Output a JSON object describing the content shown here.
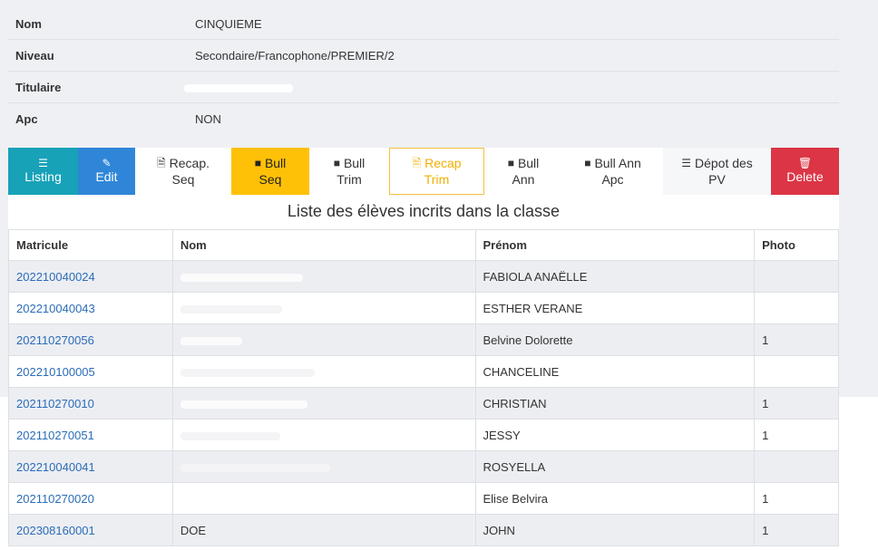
{
  "info": [
    {
      "label": "Nom",
      "value": "CINQUIEME"
    },
    {
      "label": "Niveau",
      "value": "Secondaire/Francophone/PREMIER/2"
    },
    {
      "label": "Titulaire",
      "value": ""
    },
    {
      "label": "Apc",
      "value": "NON"
    }
  ],
  "toolbar": {
    "listing": "Listing",
    "edit": "Edit",
    "recap_seq": [
      "Recap.",
      "Seq"
    ],
    "bull_seq": [
      "Bull",
      "Seq"
    ],
    "bull_trim": [
      "Bull",
      "Trim"
    ],
    "recap_trim": [
      "Recap",
      "Trim"
    ],
    "bull_ann": [
      "Bull",
      "Ann"
    ],
    "bull_ann_apc": [
      "Bull Ann",
      "Apc"
    ],
    "depot_pv": [
      "Dépot des",
      "PV"
    ],
    "delete": "Delete"
  },
  "list_title": "Liste des élèves incrits dans la classe",
  "table": {
    "headers": [
      "Matricule",
      "Nom",
      "Prénom",
      "Photo"
    ],
    "rows": [
      {
        "matricule": "202210040024",
        "nom": "",
        "prenom": "FABIOLA ANAËLLE",
        "photo": ""
      },
      {
        "matricule": "202210040043",
        "nom": "",
        "prenom": "ESTHER VERANE",
        "photo": ""
      },
      {
        "matricule": "202110270056",
        "nom": "",
        "prenom": "Belvine Dolorette",
        "photo": "1"
      },
      {
        "matricule": "202210100005",
        "nom": "",
        "prenom": "CHANCELINE",
        "photo": ""
      },
      {
        "matricule": "202110270010",
        "nom": "",
        "prenom": "CHRISTIAN",
        "photo": "1"
      },
      {
        "matricule": "202110270051",
        "nom": "",
        "prenom": "JESSY",
        "photo": "1"
      },
      {
        "matricule": "202210040041",
        "nom": "",
        "prenom": "ROSYELLA",
        "photo": ""
      },
      {
        "matricule": "202110270020",
        "nom": "",
        "prenom": "Elise Belvira",
        "photo": "1"
      },
      {
        "matricule": "202308160001",
        "nom": "DOE",
        "prenom": "JOHN",
        "photo": "1"
      }
    ]
  },
  "colors": {
    "listing": "#17a2b8",
    "edit": "#2f86d8",
    "bull_seq": "#ffc107",
    "delete": "#dc3545",
    "link": "#2b6cb8"
  },
  "icons": {
    "listing": "list-icon",
    "edit": "edit-icon",
    "recap_seq": "excel-file-icon",
    "bull_seq": "file-icon",
    "bull_trim": "file-icon",
    "recap_trim": "excel-file-icon",
    "bull_ann": "file-icon",
    "bull_ann_apc": "file-icon",
    "depot_pv": "list-icon",
    "delete": "trash-icon"
  }
}
